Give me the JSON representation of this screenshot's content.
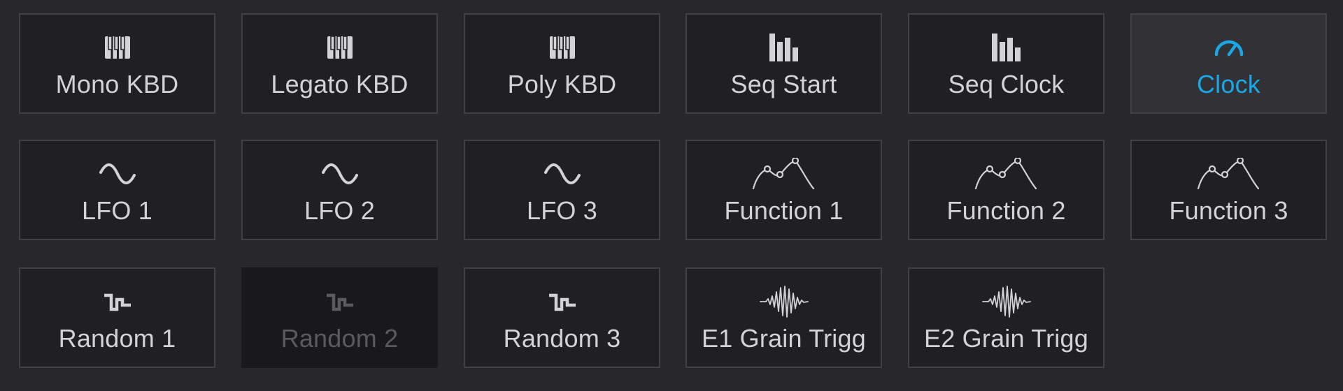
{
  "colors": {
    "background": "#28282b",
    "tile": "#202023",
    "tile_border": "#414145",
    "text": "#d3d3d6",
    "active_accent": "#1aa7e5",
    "disabled_text": "#5b5b5e"
  },
  "sources": [
    {
      "label": "Mono KBD",
      "icon": "keyboard-icon",
      "state": "normal"
    },
    {
      "label": "Legato KBD",
      "icon": "keyboard-icon",
      "state": "normal"
    },
    {
      "label": "Poly KBD",
      "icon": "keyboard-icon",
      "state": "normal"
    },
    {
      "label": "Seq Start",
      "icon": "sequencer-icon",
      "state": "normal"
    },
    {
      "label": "Seq Clock",
      "icon": "sequencer-icon",
      "state": "normal"
    },
    {
      "label": "Clock",
      "icon": "gauge-icon",
      "state": "active"
    },
    {
      "label": "LFO 1",
      "icon": "sine-wave-icon",
      "state": "normal"
    },
    {
      "label": "LFO 2",
      "icon": "sine-wave-icon",
      "state": "normal"
    },
    {
      "label": "LFO 3",
      "icon": "sine-wave-icon",
      "state": "normal"
    },
    {
      "label": "Function 1",
      "icon": "envelope-function-icon",
      "state": "normal"
    },
    {
      "label": "Function 2",
      "icon": "envelope-function-icon",
      "state": "normal"
    },
    {
      "label": "Function 3",
      "icon": "envelope-function-icon",
      "state": "normal"
    },
    {
      "label": "Random 1",
      "icon": "random-step-icon",
      "state": "normal"
    },
    {
      "label": "Random 2",
      "icon": "random-step-icon",
      "state": "disabled"
    },
    {
      "label": "Random 3",
      "icon": "random-step-icon",
      "state": "normal"
    },
    {
      "label": "E1 Grain Trigg",
      "icon": "grain-burst-icon",
      "state": "normal"
    },
    {
      "label": "E2 Grain Trigg",
      "icon": "grain-burst-icon",
      "state": "normal"
    }
  ]
}
